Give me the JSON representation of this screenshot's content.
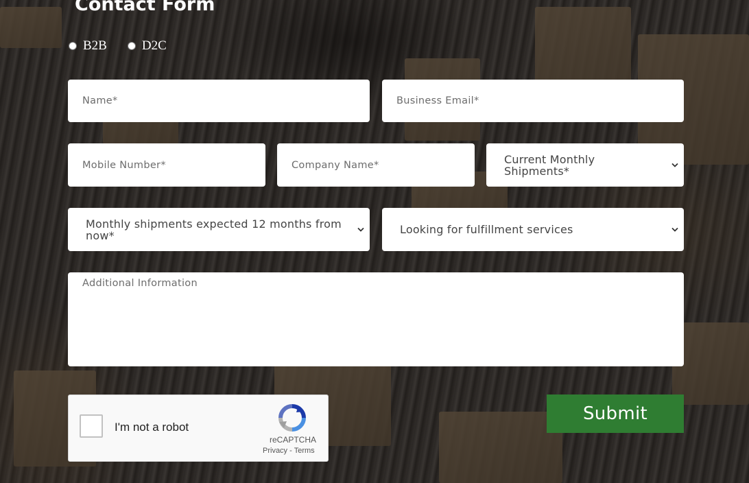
{
  "form": {
    "title": "Contact Form",
    "business_type": {
      "options": [
        "B2B",
        "D2C"
      ]
    },
    "fields": {
      "name": "Name*",
      "business_email": "Business Email*",
      "mobile_number": "Mobile Number*",
      "company_name": "Company Name*",
      "additional_info": "Additional Information"
    },
    "selects": {
      "current_monthly_shipments": "Current Monthly Shipments*",
      "expected_shipments": "Monthly shipments expected 12 months from now*",
      "fulfillment_services": "Looking for fulfillment services"
    },
    "submit_label": "Submit"
  },
  "captcha": {
    "label": "I'm not a robot",
    "brand": "reCAPTCHA",
    "privacy": "Privacy",
    "separator": "-",
    "terms": "Terms"
  },
  "icons": {
    "select": "chevron-down-icon",
    "captcha": "recaptcha-logo-icon"
  },
  "colors": {
    "submit_bg": "#2f7d32",
    "field_bg": "#ffffff",
    "title_text": "#ffffff"
  }
}
